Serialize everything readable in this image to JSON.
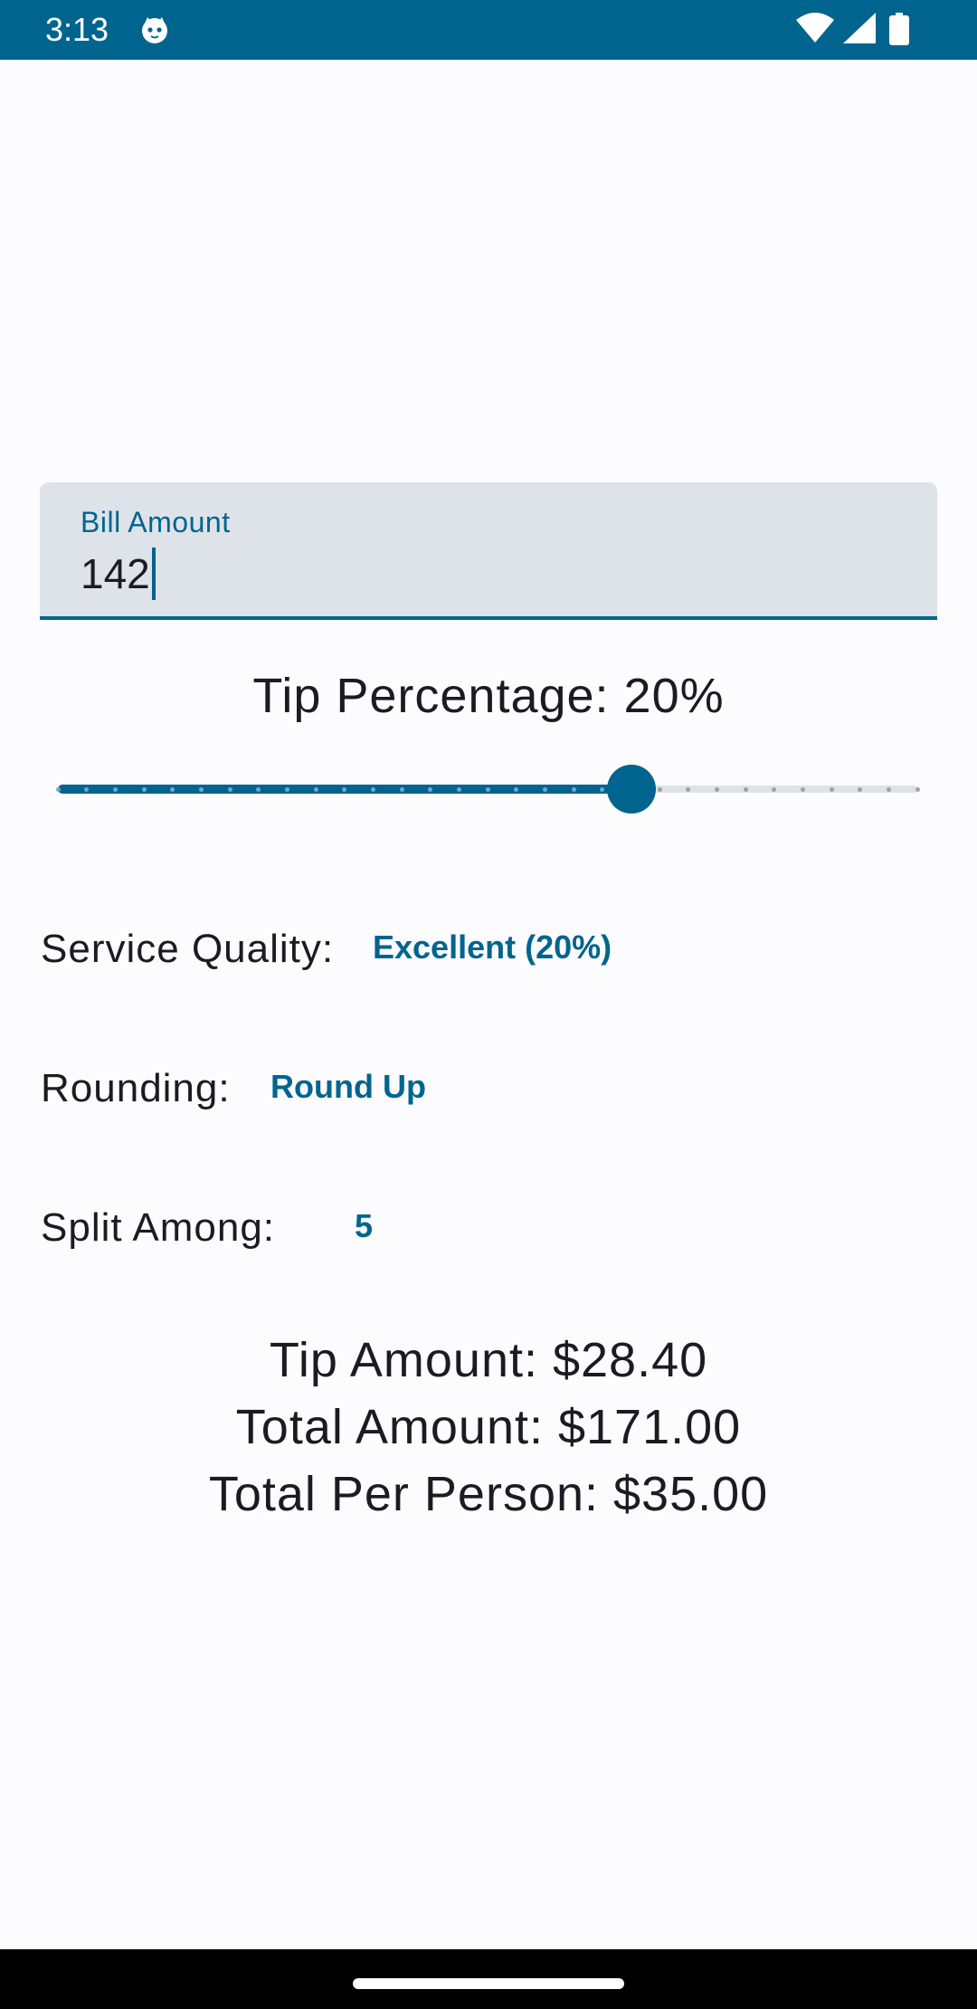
{
  "status_bar": {
    "time": "3:13",
    "icons": [
      "cat-notification-icon",
      "wifi-icon",
      "signal-icon",
      "battery-icon"
    ]
  },
  "bill": {
    "label": "Bill Amount",
    "value": "142"
  },
  "tip": {
    "label": "Tip Percentage: 20%",
    "slider_value_fraction": 0.667,
    "slider_steps": 30
  },
  "service_quality": {
    "label": "Service Quality:",
    "value": "Excellent (20%)"
  },
  "rounding": {
    "label": "Rounding:",
    "value": "Round Up"
  },
  "split": {
    "label": "Split Among:",
    "value": "5"
  },
  "results": {
    "tip_amount": "Tip Amount: $28.40",
    "total_amount": "Total Amount: $171.00",
    "per_person": "Total Per Person: $35.00"
  },
  "colors": {
    "primary": "#00658e",
    "field_bg": "#dde3e8",
    "background": "#fcfbfe"
  }
}
